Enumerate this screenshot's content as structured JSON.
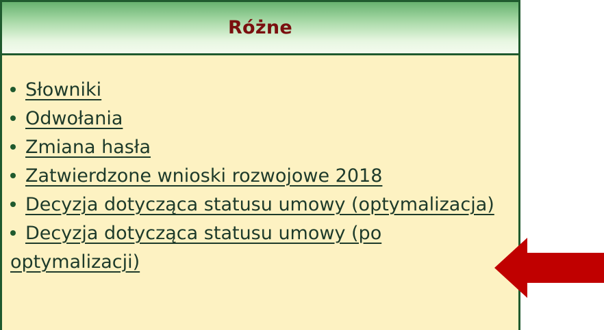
{
  "panel": {
    "title": "Różne",
    "items": [
      {
        "label": "Słowniki"
      },
      {
        "label": "Odwołania"
      },
      {
        "label": "Zmiana hasła"
      },
      {
        "label": "Zatwierdzone wnioski rozwojowe 2018"
      },
      {
        "label": "Decyzja dotycząca statusu umowy (optymalizacja)"
      },
      {
        "label": "Decyzja dotycząca statusu umowy (po optymalizacji)"
      }
    ]
  },
  "colors": {
    "header_border": "#1f5a2e",
    "title": "#7a0f0f",
    "body_background": "#fdf2c2",
    "arrow": "#c00000"
  }
}
